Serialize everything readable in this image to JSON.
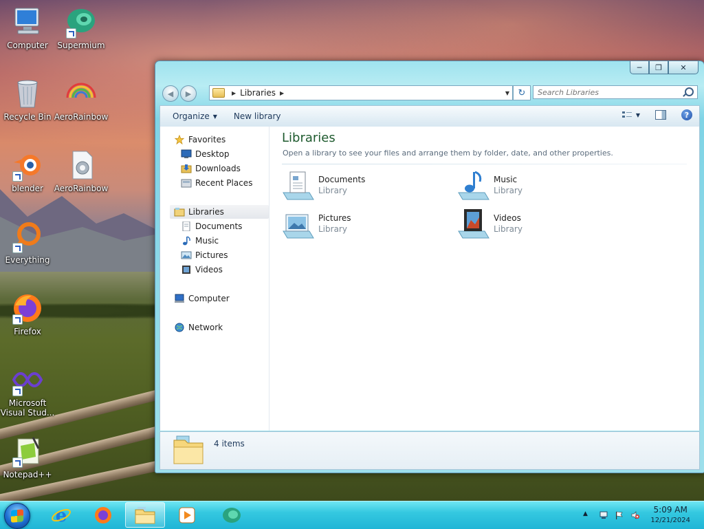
{
  "desktop": {
    "icons": [
      {
        "label": "Computer"
      },
      {
        "label": "Supermium"
      },
      {
        "label": "Recycle Bin"
      },
      {
        "label": "AeroRainbow"
      },
      {
        "label": "blender"
      },
      {
        "label": "AeroRainbow"
      },
      {
        "label": "Everything"
      },
      {
        "label": "Firefox"
      },
      {
        "label": "Microsoft Visual Stud..."
      },
      {
        "label": "Notepad++"
      }
    ]
  },
  "window": {
    "address": {
      "segments": [
        "Libraries"
      ]
    },
    "search": {
      "placeholder": "Search Libraries"
    },
    "toolbar": {
      "organize_label": "Organize",
      "new_library_label": "New library"
    },
    "nav": {
      "favorites": "Favorites",
      "desktop": "Desktop",
      "downloads": "Downloads",
      "recent": "Recent Places",
      "libraries": "Libraries",
      "documents": "Documents",
      "music": "Music",
      "pictures": "Pictures",
      "videos": "Videos",
      "computer": "Computer",
      "network": "Network"
    },
    "main": {
      "title": "Libraries",
      "description": "Open a library to see your files and arrange them by folder, date, and other properties.",
      "libraries": [
        {
          "name": "Documents",
          "type": "Library"
        },
        {
          "name": "Music",
          "type": "Library"
        },
        {
          "name": "Pictures",
          "type": "Library"
        },
        {
          "name": "Videos",
          "type": "Library"
        }
      ]
    },
    "details": {
      "count": "4 items"
    }
  },
  "taskbar": {
    "clock": {
      "time": "5:09 AM",
      "date": "12/21/2024"
    }
  },
  "colors": {
    "taskbar": "#20b5d6",
    "library_title": "#1e5a2e",
    "window_frame": "#9ddfeb"
  }
}
